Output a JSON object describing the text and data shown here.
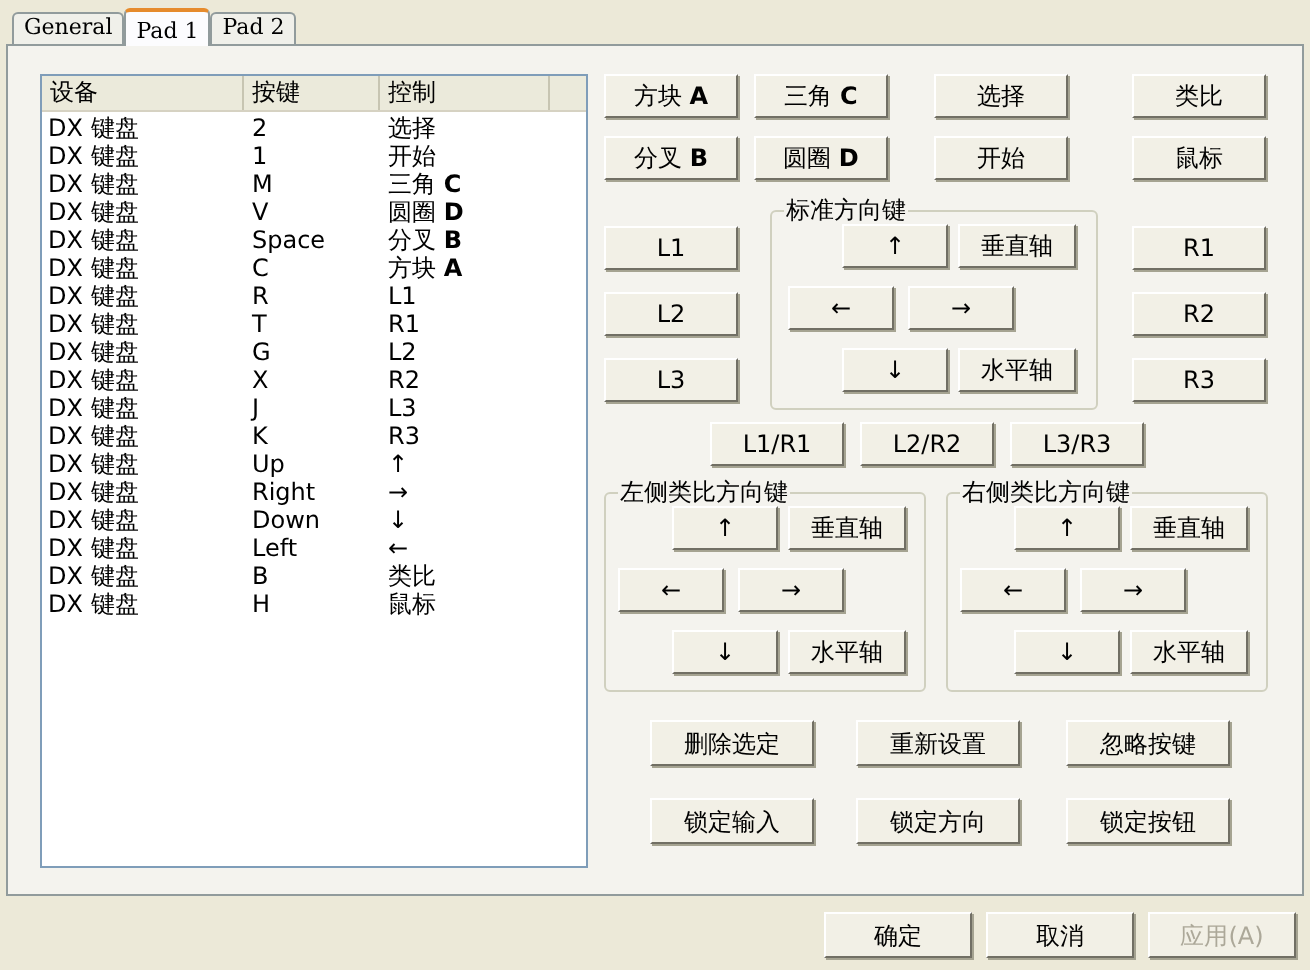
{
  "tabs": [
    {
      "label": "General",
      "selected": false
    },
    {
      "label": "Pad 1",
      "selected": true
    },
    {
      "label": "Pad 2",
      "selected": false
    }
  ],
  "list": {
    "columns": [
      "设备",
      "按键",
      "控制"
    ],
    "rows": [
      {
        "device": "DX 键盘",
        "key": "2",
        "control": "选择"
      },
      {
        "device": "DX 键盘",
        "key": "1",
        "control": "开始"
      },
      {
        "device": "DX 键盘",
        "key": "M",
        "control": "三角 **C**"
      },
      {
        "device": "DX 键盘",
        "key": "V",
        "control": "圆圈 **D**"
      },
      {
        "device": "DX 键盘",
        "key": "Space",
        "control": "分叉 **B**"
      },
      {
        "device": "DX 键盘",
        "key": "C",
        "control": "方块 **A**"
      },
      {
        "device": "DX 键盘",
        "key": "R",
        "control": "L1"
      },
      {
        "device": "DX 键盘",
        "key": "T",
        "control": "R1"
      },
      {
        "device": "DX 键盘",
        "key": "G",
        "control": "L2"
      },
      {
        "device": "DX 键盘",
        "key": "X",
        "control": "R2"
      },
      {
        "device": "DX 键盘",
        "key": "J",
        "control": "L3"
      },
      {
        "device": "DX 键盘",
        "key": "K",
        "control": "R3"
      },
      {
        "device": "DX 键盘",
        "key": "Up",
        "control": "↑"
      },
      {
        "device": "DX 键盘",
        "key": "Right",
        "control": "→"
      },
      {
        "device": "DX 键盘",
        "key": "Down",
        "control": "↓"
      },
      {
        "device": "DX 键盘",
        "key": "Left",
        "control": "←"
      },
      {
        "device": "DX 键盘",
        "key": "B",
        "control": "类比"
      },
      {
        "device": "DX 键盘",
        "key": "H",
        "control": "鼠标"
      }
    ]
  },
  "face_buttons": [
    "方块 **A**",
    "三角 **C**",
    "选择",
    "类比",
    "分叉 **B**",
    "圆圈 **D**",
    "开始",
    "鼠标"
  ],
  "shoulder_left": [
    "L1",
    "L2",
    "L3"
  ],
  "shoulder_right": [
    "R1",
    "R2",
    "R3"
  ],
  "standard_dpad": {
    "title": "标准方向键",
    "up": "↑",
    "vertical_axis": "垂直轴",
    "left": "←",
    "right": "→",
    "down": "↓",
    "horizontal_axis": "水平轴"
  },
  "combo_buttons": [
    "L1/R1",
    "L2/R2",
    "L3/R3"
  ],
  "left_analog": {
    "title": "左侧类比方向键",
    "up": "↑",
    "vertical_axis": "垂直轴",
    "left": "←",
    "right": "→",
    "down": "↓",
    "horizontal_axis": "水平轴"
  },
  "right_analog": {
    "title": "右侧类比方向键",
    "up": "↑",
    "vertical_axis": "垂直轴",
    "left": "←",
    "right": "→",
    "down": "↓",
    "horizontal_axis": "水平轴"
  },
  "action_buttons": [
    "删除选定",
    "重新设置",
    "忽略按键",
    "锁定输入",
    "锁定方向",
    "锁定按钮"
  ],
  "dialog_buttons": [
    {
      "label": "确定",
      "disabled": false
    },
    {
      "label": "取消",
      "disabled": false
    },
    {
      "label": "应用(A)",
      "disabled": true
    }
  ]
}
